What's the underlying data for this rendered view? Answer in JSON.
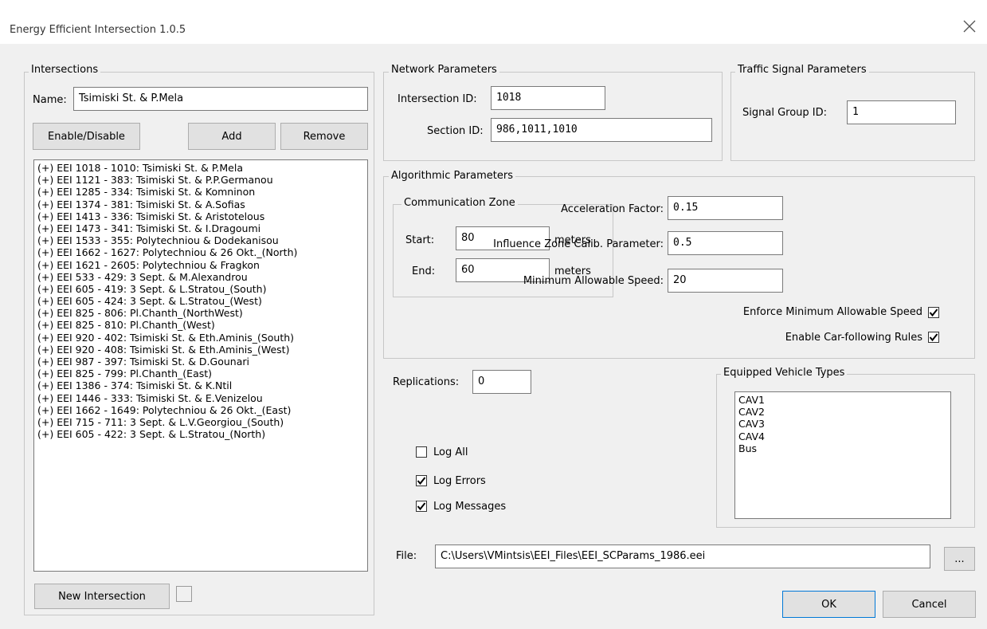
{
  "window": {
    "title": "Energy Efficient Intersection 1.0.5",
    "close_glyph": "✕"
  },
  "intersections": {
    "legend": "Intersections",
    "name_label": "Name:",
    "name_value": "Tsimiski St. & P.Mela",
    "enable_disable": "Enable/Disable",
    "add": "Add",
    "remove": "Remove",
    "items": [
      "(+) EEI 1018 - 1010: Tsimiski St. & P.Mela",
      "(+) EEI 1121 - 383: Tsimiski St. & P.P.Germanou",
      "(+) EEI 1285 - 334: Tsimiski St. & Komninon",
      "(+) EEI 1374 - 381: Tsimiski St. & A.Sofias",
      "(+) EEI 1413 - 336: Tsimiski St. & Aristotelous",
      "(+) EEI 1473 - 341: Tsimiski St. & I.Dragoumi",
      "(+) EEI 1533 - 355: Polytechniou & Dodekanisou",
      "(+) EEI 1662 - 1627: Polytechniou & 26 Okt._(North)",
      "(+) EEI 1621 - 2605: Polytechniou & Fragkon",
      "(+) EEI 533 - 429: 3 Sept. & M.Alexandrou",
      "(+) EEI 605 - 419: 3 Sept. & L.Stratou_(South)",
      "(+) EEI 605 - 424: 3 Sept. & L.Stratou_(West)",
      "(+) EEI 825 - 806: Pl.Chanth_(NorthWest)",
      "(+) EEI 825 - 810: Pl.Chanth_(West)",
      "(+) EEI 920 - 402: Tsimiski St. & Eth.Aminis_(South)",
      "(+) EEI 920 - 408: Tsimiski St. & Eth.Aminis_(West)",
      "(+) EEI 987 - 397: Tsimiski St. & D.Gounari",
      "(+) EEI 825 - 799: Pl.Chanth_(East)",
      "(+) EEI 1386 - 374: Tsimiski St. & K.Ntil",
      "(+) EEI 1446 - 333: Tsimiski St. & E.Venizelou",
      "(+) EEI 1662 - 1649: Polytechniou & 26 Okt._(East)",
      "(+) EEI 715 - 711: 3 Sept. & L.V.Georgiou_(South)",
      "(+) EEI 605 - 422: 3 Sept. & L.Stratou_(North)"
    ],
    "new_intersection": "New Intersection",
    "new_intersection_checked": false
  },
  "network": {
    "legend": "Network Parameters",
    "intersection_id_label": "Intersection ID:",
    "intersection_id_value": "1018",
    "section_id_label": "Section ID:",
    "section_id_value": "986,1011,1010"
  },
  "signal": {
    "legend": "Traffic Signal Parameters",
    "group_id_label": "Signal Group ID:",
    "group_id_value": "1"
  },
  "algorithmic": {
    "legend": "Algorithmic Parameters",
    "comm_zone_legend": "Communication Zone",
    "start_label": "Start:",
    "start_value": "80",
    "start_unit": "meters",
    "end_label": "End:",
    "end_value": "60",
    "end_unit": "meters",
    "accel_label": "Acceleration Factor:",
    "accel_value": "0.15",
    "influence_label": "Influence Zone Calib. Parameter:",
    "influence_value": "0.5",
    "min_speed_label": "Minimum Allowable Speed:",
    "min_speed_value": "20",
    "enforce_label": "Enforce Minimum Allowable Speed",
    "enforce_checked": true,
    "carfollow_label": "Enable Car-following Rules",
    "carfollow_checked": true
  },
  "replications": {
    "label": "Replications:",
    "value": "0"
  },
  "logging": {
    "log_all": {
      "label": "Log All",
      "checked": false
    },
    "log_errors": {
      "label": "Log Errors",
      "checked": true
    },
    "log_messages": {
      "label": "Log Messages",
      "checked": true
    }
  },
  "vehicles": {
    "legend": "Equipped Vehicle Types",
    "items": [
      "CAV1",
      "CAV2",
      "CAV3",
      "CAV4",
      "Bus"
    ]
  },
  "file": {
    "label": "File:",
    "value": "C:\\Users\\VMintsis\\EEI_Files\\EEI_SCParams_1986.eei",
    "browse": "..."
  },
  "footer": {
    "ok": "OK",
    "cancel": "Cancel"
  }
}
